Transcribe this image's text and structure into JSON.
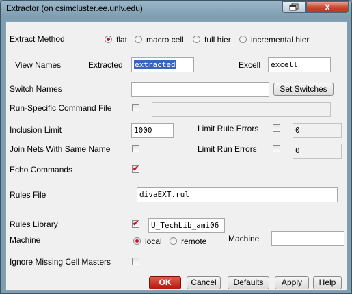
{
  "window": {
    "title": "Extractor (on csimcluster.ee.unlv.edu)",
    "close_glyph": "X"
  },
  "extract_method": {
    "label": "Extract Method",
    "options": [
      "flat",
      "macro cell",
      "full hier",
      "incremental hier"
    ],
    "selected": "flat"
  },
  "view_names": {
    "label": "View Names",
    "extracted_label": "Extracted",
    "extracted_value": "extracted",
    "excell_label": "Excell",
    "excell_value": "excell"
  },
  "switch_names": {
    "label": "Switch Names",
    "value": "",
    "button": "Set Switches"
  },
  "run_specific": {
    "label": "Run-Specific Command File",
    "checked": false,
    "value": ""
  },
  "inclusion_limit": {
    "label": "Inclusion Limit",
    "value": "1000"
  },
  "limit_rule_errors": {
    "label": "Limit Rule Errors",
    "checked": false,
    "value": "0"
  },
  "join_nets": {
    "label": "Join Nets With Same Name",
    "checked": false
  },
  "limit_run_errors": {
    "label": "Limit Run Errors",
    "checked": false,
    "value": "0"
  },
  "echo_commands": {
    "label": "Echo Commands",
    "checked": true
  },
  "rules_file": {
    "label": "Rules File",
    "value": "divaEXT.rul"
  },
  "rules_library": {
    "label": "Rules Library",
    "checked": true,
    "value": "U_TechLib_ami06"
  },
  "machine": {
    "label": "Machine",
    "options": [
      "local",
      "remote"
    ],
    "selected": "local",
    "machine_label": "Machine",
    "value": ""
  },
  "ignore_missing": {
    "label": "Ignore Missing Cell Masters",
    "checked": false
  },
  "buttons": {
    "ok": "OK",
    "cancel": "Cancel",
    "defaults": "Defaults",
    "apply": "Apply",
    "help": "Help"
  },
  "check_glyph": "✔",
  "colors": {
    "accent": "#c8102e",
    "ok_button": "#c4241a",
    "selection": "#3a64c4"
  }
}
